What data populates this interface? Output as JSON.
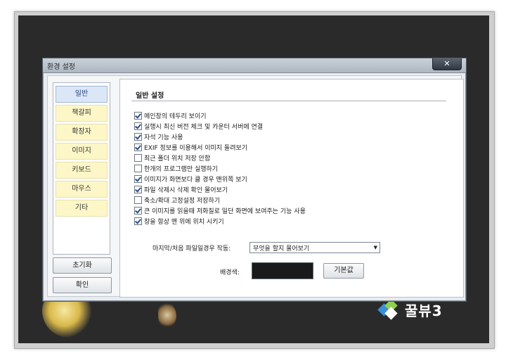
{
  "dialog": {
    "title": "환경 설정",
    "close_glyph": "✕"
  },
  "sidebar": {
    "items": [
      {
        "label": "일반",
        "active": true
      },
      {
        "label": "책갈피",
        "active": false
      },
      {
        "label": "확장자",
        "active": false
      },
      {
        "label": "이미지",
        "active": false
      },
      {
        "label": "키보드",
        "active": false
      },
      {
        "label": "마우스",
        "active": false
      },
      {
        "label": "기타",
        "active": false
      }
    ],
    "reset_label": "초기화",
    "ok_label": "확인"
  },
  "general": {
    "section_title": "일반 설정",
    "options": [
      {
        "label": "메인창의 테두리 보이기",
        "checked": true
      },
      {
        "label": "실행시 최신 버전 체크 및 카운터 서버에 연결",
        "checked": true
      },
      {
        "label": "자석 기능 사용",
        "checked": true
      },
      {
        "label": "EXIF 정보를 이용해서 이미지 돌려보기",
        "checked": true
      },
      {
        "label": "최근 폴더 위치 저장 안함",
        "checked": false
      },
      {
        "label": "한개의 프로그램만 실행하기",
        "checked": false
      },
      {
        "label": "이미지가 화면보다 클 경우 맨위쪽 보기",
        "checked": true
      },
      {
        "label": "파일 삭제시 삭제 확인 물어보기",
        "checked": true
      },
      {
        "label": "축소/확대 고정설정 저장하기",
        "checked": false
      },
      {
        "label": "큰 이미지를 읽을때 저화질로 일단 화면에 보여주는 기능 사용",
        "checked": true
      },
      {
        "label": "창을 항상 맨 위에 위치 시키기",
        "checked": true
      }
    ],
    "last_file_label": "마지막/처음 파일일경우 작동:",
    "last_file_value": "무엇을 할지 물어보기",
    "bg_color_label": "배경색:",
    "bg_color_value": "#1a1a1a",
    "default_button_label": "기본값"
  },
  "background": {
    "logo_text": "꿀뷰3",
    "app_bg_color": "#2a2a2a"
  }
}
